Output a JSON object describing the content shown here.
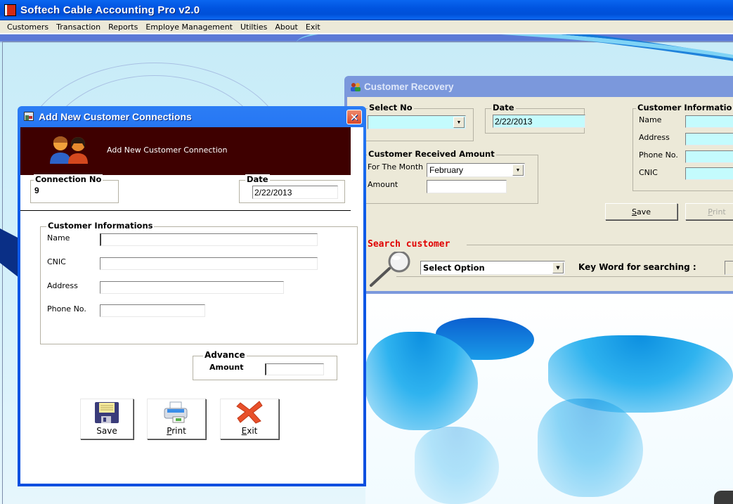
{
  "app": {
    "title": "Softech Cable Accounting Pro v2.0",
    "icon": "app-book-icon"
  },
  "menu": {
    "items": [
      {
        "label": "Customers"
      },
      {
        "label": "Transaction"
      },
      {
        "label": "Reports"
      },
      {
        "label": "Employe Management"
      },
      {
        "label": "Utilties"
      },
      {
        "label": "About"
      },
      {
        "label": "Exit"
      }
    ]
  },
  "recovery": {
    "title": "Customer Recovery",
    "icon": "users-icon",
    "select_no": {
      "legend": "Select No",
      "value": ""
    },
    "date": {
      "legend": "Date",
      "value": "2/22/2013"
    },
    "received": {
      "legend": "Customer Received Amount",
      "month_label": "For The Month",
      "month_value": "February",
      "amount_label": "Amount",
      "amount_value": ""
    },
    "customer_info": {
      "legend": "Customer Informatio",
      "fields": [
        {
          "label": "Name",
          "value": ""
        },
        {
          "label": "Address",
          "value": ""
        },
        {
          "label": "Phone No.",
          "value": ""
        },
        {
          "label": "CNIC",
          "value": ""
        }
      ]
    },
    "buttons": {
      "save": {
        "prefix": "S",
        "rest": "ave"
      },
      "print": {
        "prefix": "P",
        "rest": "rint"
      }
    },
    "search": {
      "legend": "Search customer",
      "legend_color": "#e00000",
      "option_value": "Select Option",
      "keyword_label": "Key Word for searching :",
      "keyword_value": ""
    }
  },
  "addcust": {
    "title": "Add New Customer Connections",
    "header_text": "Add New Customer Connection",
    "header_bg": "#3e0000",
    "connection": {
      "legend": "Connection No",
      "value": "9"
    },
    "date": {
      "legend": "Date",
      "value": "2/22/2013"
    },
    "info": {
      "legend": "Customer Informations",
      "fields": [
        {
          "label": "Name",
          "value": ""
        },
        {
          "label": "CNIC",
          "value": ""
        },
        {
          "label": "Address",
          "value": ""
        },
        {
          "label": "Phone No.",
          "value": ""
        }
      ]
    },
    "advance": {
      "legend": "Advance",
      "label": "Amount",
      "value": ""
    },
    "buttons": {
      "save": {
        "label": "Save",
        "icon": "floppy-disk-icon"
      },
      "print": {
        "prefix": "P",
        "rest": "rint",
        "icon": "printer-icon"
      },
      "exit": {
        "prefix": "E",
        "rest": "xit",
        "icon": "red-x-icon"
      }
    }
  }
}
